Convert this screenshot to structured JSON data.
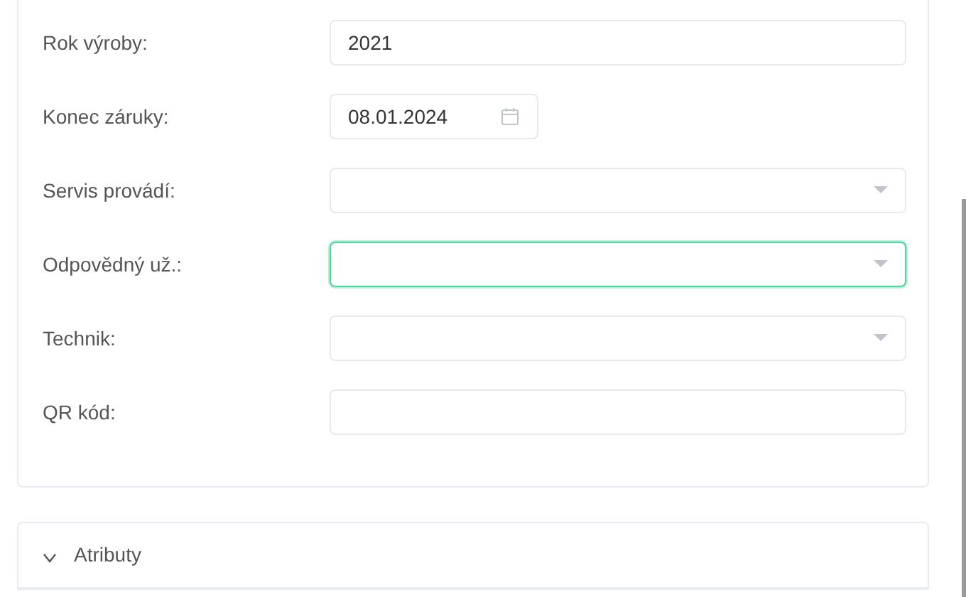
{
  "form_fields": [
    {
      "label": "Rok výroby:",
      "kind": "text",
      "value": "2021",
      "focused": false
    },
    {
      "label": "Konec záruky:",
      "kind": "date",
      "value": "08.01.2024",
      "focused": false
    },
    {
      "label": "Servis provádí:",
      "kind": "select",
      "focused": false
    },
    {
      "label": "Odpovědný už.:",
      "kind": "select",
      "focused": true
    },
    {
      "label": "Technik:",
      "kind": "select",
      "focused": false
    },
    {
      "label": "QR kód:",
      "kind": "text",
      "focused": false
    }
  ],
  "sections": [
    {
      "title": "Atributy",
      "expanded": true
    }
  ]
}
